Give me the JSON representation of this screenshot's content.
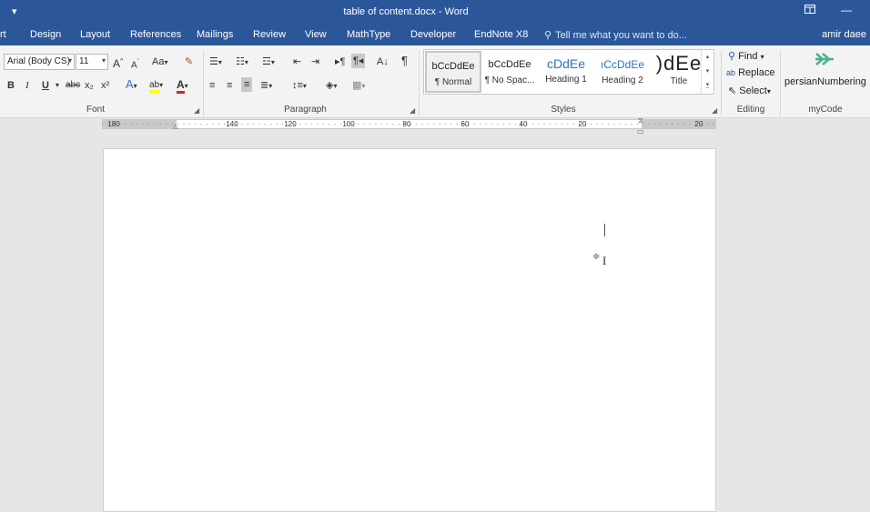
{
  "titlebar": {
    "qat_icon": "customize-qat-icon",
    "title": "table of content.docx - Word",
    "restore_icon": "ribbon-display-icon",
    "minimize_icon": "minimize-icon"
  },
  "tabs": [
    {
      "label": "rt"
    },
    {
      "label": "Design"
    },
    {
      "label": "Layout"
    },
    {
      "label": "References"
    },
    {
      "label": "Mailings"
    },
    {
      "label": "Review"
    },
    {
      "label": "View"
    },
    {
      "label": "MathType"
    },
    {
      "label": "Developer"
    },
    {
      "label": "EndNote X8"
    }
  ],
  "tellme": {
    "text": "Tell me what you want to do..."
  },
  "user": {
    "name": "amir daee"
  },
  "font_group": {
    "label": "Font",
    "font_name": "Arial (Body CS)",
    "font_size": "11",
    "case_label": "Aa",
    "bold": "B",
    "italic": "I",
    "underline": "U",
    "strike": "abc",
    "subscript": "x₂",
    "superscript": "x²",
    "font_color_letter": "A",
    "highlight_letter": "ab",
    "grow_label": "A",
    "shrink_label": "A",
    "effects_letter": "A"
  },
  "paragraph_group": {
    "label": "Paragraph",
    "pilcrow": "¶"
  },
  "styles_group": {
    "label": "Styles",
    "items": [
      {
        "preview": "bCcDdEe",
        "label": "¶ Normal"
      },
      {
        "preview": "bCcDdEe",
        "label": "¶ No Spac..."
      },
      {
        "preview": "cDdEe",
        "label": "Heading 1"
      },
      {
        "preview": "ıCcDdEe",
        "label": "Heading 2"
      },
      {
        "preview": ")dEe",
        "label": "Title"
      }
    ]
  },
  "editing_group": {
    "label": "Editing",
    "find": "Find",
    "replace": "Replace",
    "select": "Select"
  },
  "mycode_group": {
    "label": "myCode",
    "button": "persianNumbering"
  },
  "ruler": {
    "labels": [
      "180",
      "140",
      "120",
      "100",
      "80",
      "60",
      "40",
      "20",
      "20"
    ]
  },
  "colors": {
    "accent": "#2b579a",
    "ribbon_bg": "#f3f3f3",
    "workspace": "#e6e6e6",
    "persian_icon": "#4caf8f"
  }
}
